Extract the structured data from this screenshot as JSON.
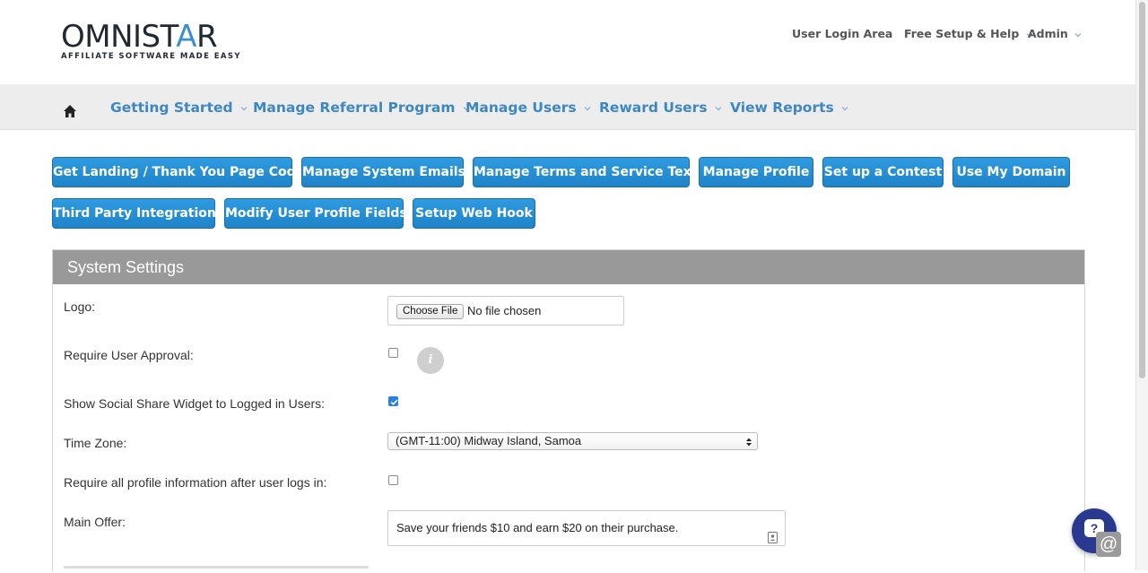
{
  "brand": {
    "logo_prefix": "OMNIST",
    "logo_accent": "A",
    "logo_suffix": "R",
    "tagline": "AFFILIATE SOFTWARE MADE EASY",
    "accent_color": "#3a8fd0"
  },
  "top_links": {
    "user_login": "User Login Area",
    "setup_help": "Free Setup & Help",
    "admin": "Admin"
  },
  "nav": {
    "home_icon": "home-icon",
    "items": [
      {
        "label": "Getting Started"
      },
      {
        "label": "Manage Referral Program"
      },
      {
        "label": "Manage Users"
      },
      {
        "label": "Reward Users"
      },
      {
        "label": "View Reports"
      }
    ]
  },
  "action_buttons": [
    {
      "label": "Get Landing / Thank You Page Code"
    },
    {
      "label": "Manage System Emails"
    },
    {
      "label": "Manage Terms and Service Text"
    },
    {
      "label": "Manage Profile"
    },
    {
      "label": "Set up a Contest"
    },
    {
      "label": "Use My Domain"
    },
    {
      "label": "Third Party Integration"
    },
    {
      "label": "Modify User Profile Fields"
    },
    {
      "label": "Setup Web Hook"
    }
  ],
  "settings": {
    "title": "System Settings",
    "logo_label": "Logo:",
    "file_button": "Choose File",
    "file_status": "No file chosen",
    "require_approval_label": "Require User Approval:",
    "require_approval_checked": false,
    "info_glyph": "i",
    "social_share_label": "Show Social Share Widget to Logged in Users:",
    "social_share_checked": true,
    "timezone_label": "Time Zone:",
    "timezone_value": "(GMT-11:00) Midway Island, Samoa",
    "require_profile_label": "Require all profile information after user logs in:",
    "require_profile_checked": false,
    "main_offer_label": "Main Offer:",
    "main_offer_value": "Save your friends $10 and earn $20 on their purchase."
  },
  "chat": {
    "bubble_glyph": "?",
    "at_glyph": "@"
  }
}
